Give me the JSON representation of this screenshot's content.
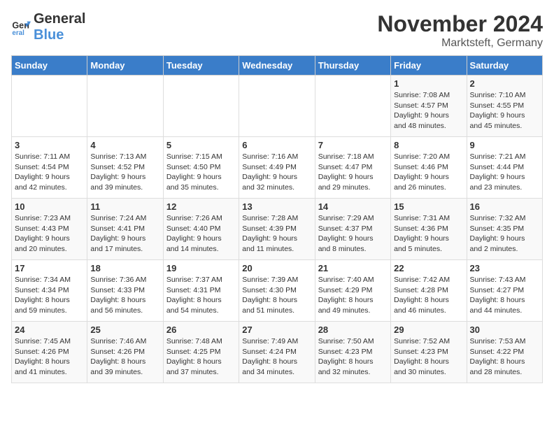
{
  "header": {
    "logo_general": "General",
    "logo_blue": "Blue",
    "month_title": "November 2024",
    "location": "Marktsteft, Germany"
  },
  "days_of_week": [
    "Sunday",
    "Monday",
    "Tuesday",
    "Wednesday",
    "Thursday",
    "Friday",
    "Saturday"
  ],
  "weeks": [
    [
      {
        "day": "",
        "info": ""
      },
      {
        "day": "",
        "info": ""
      },
      {
        "day": "",
        "info": ""
      },
      {
        "day": "",
        "info": ""
      },
      {
        "day": "",
        "info": ""
      },
      {
        "day": "1",
        "info": "Sunrise: 7:08 AM\nSunset: 4:57 PM\nDaylight: 9 hours\nand 48 minutes."
      },
      {
        "day": "2",
        "info": "Sunrise: 7:10 AM\nSunset: 4:55 PM\nDaylight: 9 hours\nand 45 minutes."
      }
    ],
    [
      {
        "day": "3",
        "info": "Sunrise: 7:11 AM\nSunset: 4:54 PM\nDaylight: 9 hours\nand 42 minutes."
      },
      {
        "day": "4",
        "info": "Sunrise: 7:13 AM\nSunset: 4:52 PM\nDaylight: 9 hours\nand 39 minutes."
      },
      {
        "day": "5",
        "info": "Sunrise: 7:15 AM\nSunset: 4:50 PM\nDaylight: 9 hours\nand 35 minutes."
      },
      {
        "day": "6",
        "info": "Sunrise: 7:16 AM\nSunset: 4:49 PM\nDaylight: 9 hours\nand 32 minutes."
      },
      {
        "day": "7",
        "info": "Sunrise: 7:18 AM\nSunset: 4:47 PM\nDaylight: 9 hours\nand 29 minutes."
      },
      {
        "day": "8",
        "info": "Sunrise: 7:20 AM\nSunset: 4:46 PM\nDaylight: 9 hours\nand 26 minutes."
      },
      {
        "day": "9",
        "info": "Sunrise: 7:21 AM\nSunset: 4:44 PM\nDaylight: 9 hours\nand 23 minutes."
      }
    ],
    [
      {
        "day": "10",
        "info": "Sunrise: 7:23 AM\nSunset: 4:43 PM\nDaylight: 9 hours\nand 20 minutes."
      },
      {
        "day": "11",
        "info": "Sunrise: 7:24 AM\nSunset: 4:41 PM\nDaylight: 9 hours\nand 17 minutes."
      },
      {
        "day": "12",
        "info": "Sunrise: 7:26 AM\nSunset: 4:40 PM\nDaylight: 9 hours\nand 14 minutes."
      },
      {
        "day": "13",
        "info": "Sunrise: 7:28 AM\nSunset: 4:39 PM\nDaylight: 9 hours\nand 11 minutes."
      },
      {
        "day": "14",
        "info": "Sunrise: 7:29 AM\nSunset: 4:37 PM\nDaylight: 9 hours\nand 8 minutes."
      },
      {
        "day": "15",
        "info": "Sunrise: 7:31 AM\nSunset: 4:36 PM\nDaylight: 9 hours\nand 5 minutes."
      },
      {
        "day": "16",
        "info": "Sunrise: 7:32 AM\nSunset: 4:35 PM\nDaylight: 9 hours\nand 2 minutes."
      }
    ],
    [
      {
        "day": "17",
        "info": "Sunrise: 7:34 AM\nSunset: 4:34 PM\nDaylight: 8 hours\nand 59 minutes."
      },
      {
        "day": "18",
        "info": "Sunrise: 7:36 AM\nSunset: 4:33 PM\nDaylight: 8 hours\nand 56 minutes."
      },
      {
        "day": "19",
        "info": "Sunrise: 7:37 AM\nSunset: 4:31 PM\nDaylight: 8 hours\nand 54 minutes."
      },
      {
        "day": "20",
        "info": "Sunrise: 7:39 AM\nSunset: 4:30 PM\nDaylight: 8 hours\nand 51 minutes."
      },
      {
        "day": "21",
        "info": "Sunrise: 7:40 AM\nSunset: 4:29 PM\nDaylight: 8 hours\nand 49 minutes."
      },
      {
        "day": "22",
        "info": "Sunrise: 7:42 AM\nSunset: 4:28 PM\nDaylight: 8 hours\nand 46 minutes."
      },
      {
        "day": "23",
        "info": "Sunrise: 7:43 AM\nSunset: 4:27 PM\nDaylight: 8 hours\nand 44 minutes."
      }
    ],
    [
      {
        "day": "24",
        "info": "Sunrise: 7:45 AM\nSunset: 4:26 PM\nDaylight: 8 hours\nand 41 minutes."
      },
      {
        "day": "25",
        "info": "Sunrise: 7:46 AM\nSunset: 4:26 PM\nDaylight: 8 hours\nand 39 minutes."
      },
      {
        "day": "26",
        "info": "Sunrise: 7:48 AM\nSunset: 4:25 PM\nDaylight: 8 hours\nand 37 minutes."
      },
      {
        "day": "27",
        "info": "Sunrise: 7:49 AM\nSunset: 4:24 PM\nDaylight: 8 hours\nand 34 minutes."
      },
      {
        "day": "28",
        "info": "Sunrise: 7:50 AM\nSunset: 4:23 PM\nDaylight: 8 hours\nand 32 minutes."
      },
      {
        "day": "29",
        "info": "Sunrise: 7:52 AM\nSunset: 4:23 PM\nDaylight: 8 hours\nand 30 minutes."
      },
      {
        "day": "30",
        "info": "Sunrise: 7:53 AM\nSunset: 4:22 PM\nDaylight: 8 hours\nand 28 minutes."
      }
    ]
  ]
}
